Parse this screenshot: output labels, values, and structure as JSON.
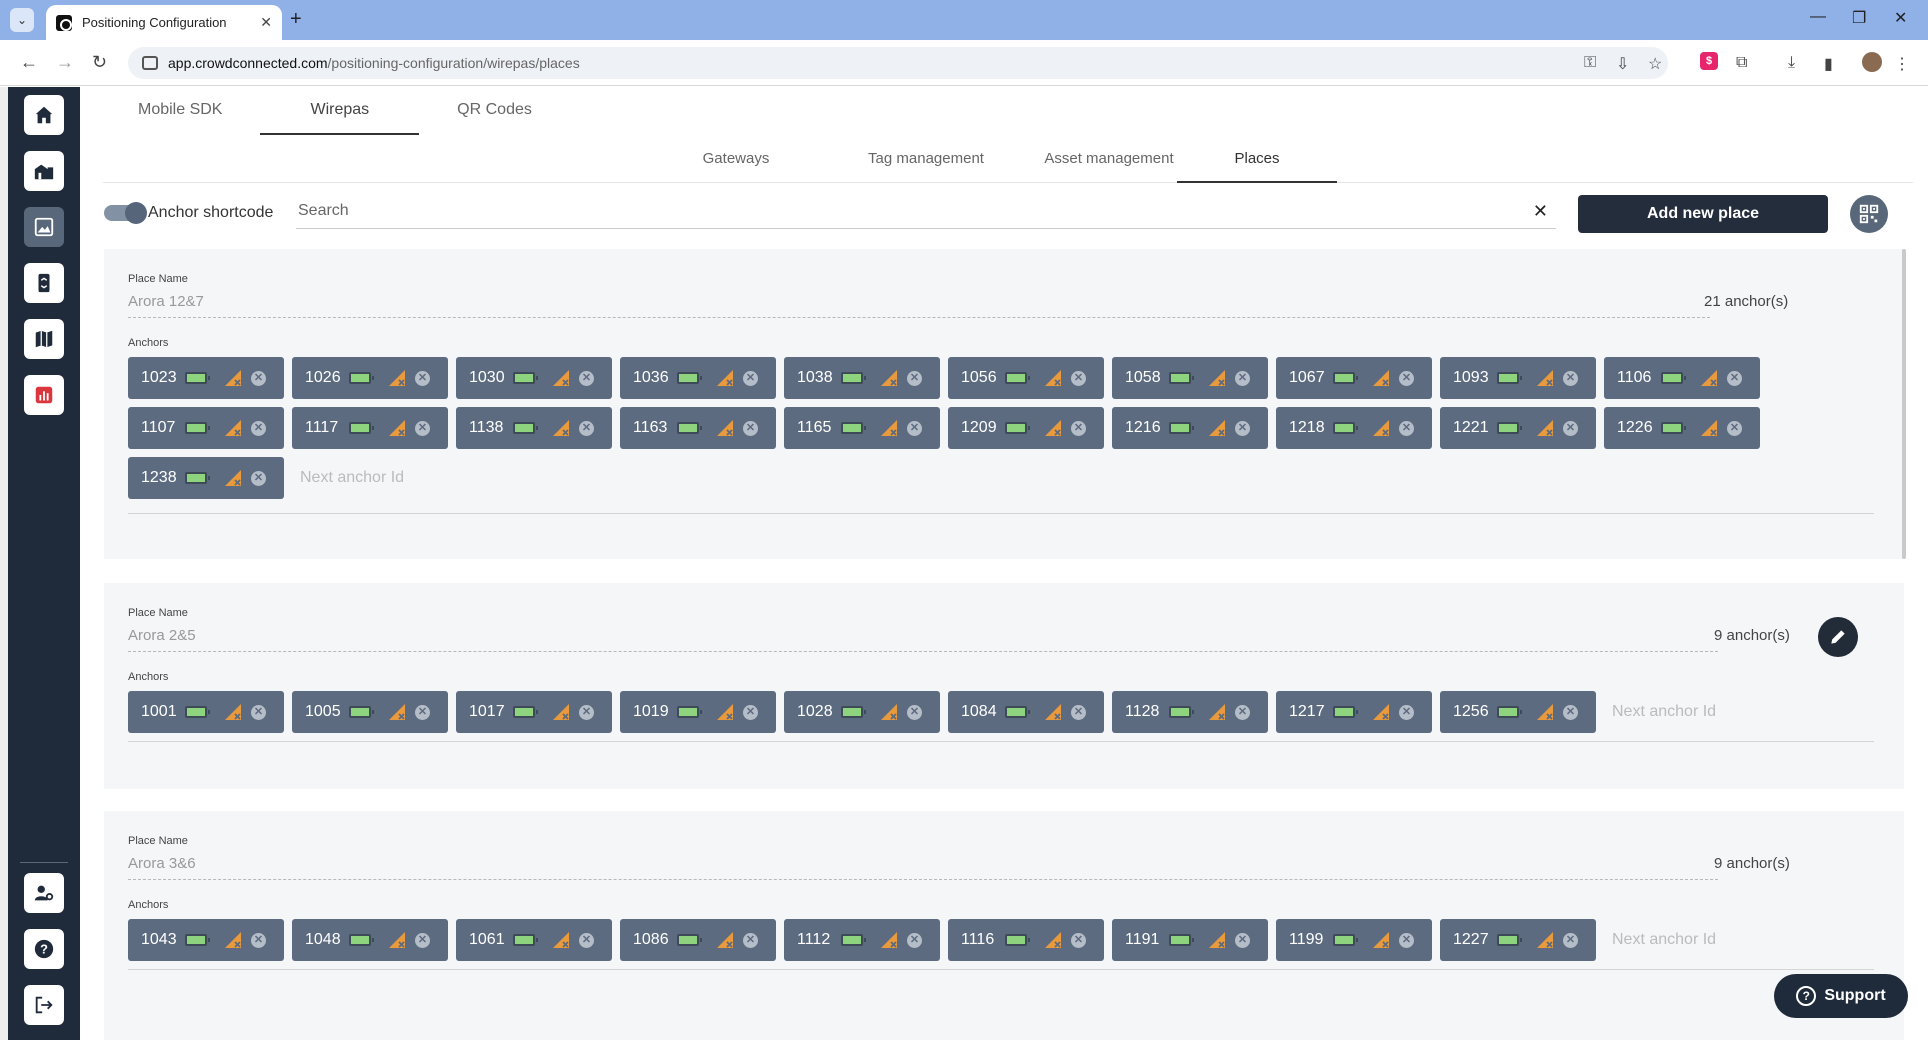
{
  "browser": {
    "tab_title": "Positioning Configuration",
    "tab_close": "✕",
    "new_tab": "+",
    "url_host": "app.crowdconnected.com",
    "url_path": "/positioning-configuration/wirepas/places"
  },
  "top_tabs": [
    {
      "label": "Mobile SDK",
      "active": false
    },
    {
      "label": "Wirepas",
      "active": true
    },
    {
      "label": "QR Codes",
      "active": false
    }
  ],
  "sub_tabs": [
    {
      "label": "Gateways",
      "active": false
    },
    {
      "label": "Tag management",
      "active": false
    },
    {
      "label": "Asset management",
      "active": false
    },
    {
      "label": "Places",
      "active": true
    }
  ],
  "toolbar": {
    "toggle_label": "Anchor shortcode",
    "toggle_on": true,
    "search_placeholder": "Search",
    "clear": "✕",
    "add_label": "Add new place"
  },
  "places": [
    {
      "label": "Place Name",
      "name": "Arora 12&7",
      "count": "21 anchor(s)",
      "anchors_label": "Anchors",
      "next_placeholder": "Next anchor Id",
      "anchors": [
        "1023",
        "1026",
        "1030",
        "1036",
        "1038",
        "1056",
        "1058",
        "1067",
        "1093",
        "1106",
        "1107",
        "1117",
        "1138",
        "1163",
        "1165",
        "1209",
        "1216",
        "1218",
        "1221",
        "1226",
        "1238"
      ]
    },
    {
      "label": "Place Name",
      "name": "Arora 2&5",
      "count": "9 anchor(s)",
      "anchors_label": "Anchors",
      "next_placeholder": "Next anchor Id",
      "anchors": [
        "1001",
        "1005",
        "1017",
        "1019",
        "1028",
        "1084",
        "1128",
        "1217",
        "1256"
      ]
    },
    {
      "label": "Place Name",
      "name": "Arora 3&6",
      "count": "9 anchor(s)",
      "anchors_label": "Anchors",
      "next_placeholder": "Next anchor Id",
      "anchors": [
        "1043",
        "1048",
        "1061",
        "1086",
        "1112",
        "1116",
        "1191",
        "1199",
        "1227"
      ]
    }
  ],
  "support": {
    "label": "Support"
  },
  "colors": {
    "sidebar": "#1f2a3a",
    "chip": "#5d6b80",
    "battery": "#8ed37e",
    "signal": "#e89a3c",
    "button": "#242d3c"
  }
}
